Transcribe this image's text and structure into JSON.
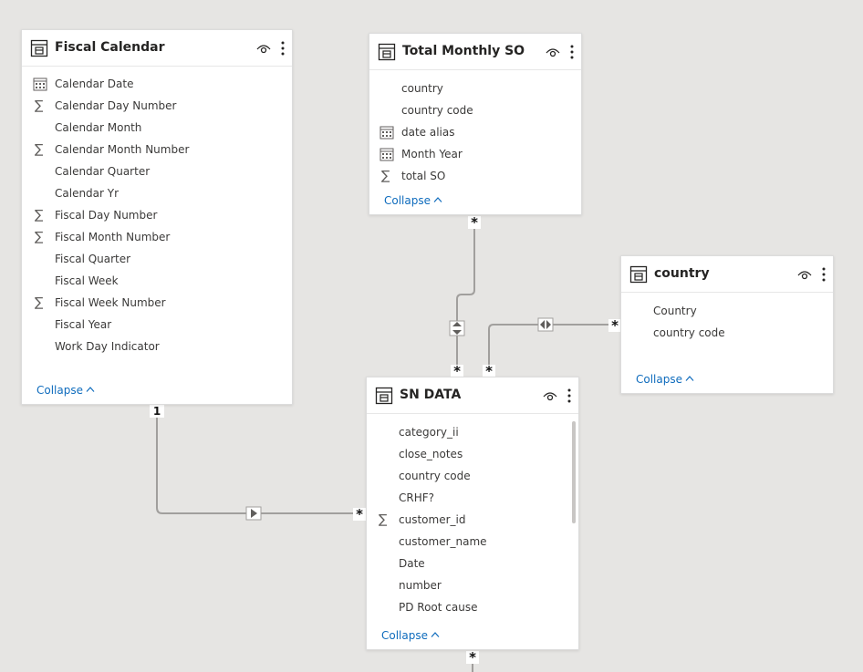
{
  "tables": {
    "fiscal_calendar": {
      "title": "Fiscal Calendar",
      "fields": [
        {
          "label": "Calendar Date",
          "icon": "calendar-icon"
        },
        {
          "label": "Calendar Day Number",
          "icon": "sigma-icon"
        },
        {
          "label": "Calendar Month",
          "icon": ""
        },
        {
          "label": "Calendar Month Number",
          "icon": "sigma-icon"
        },
        {
          "label": "Calendar Quarter",
          "icon": ""
        },
        {
          "label": "Calendar Yr",
          "icon": ""
        },
        {
          "label": "Fiscal Day Number",
          "icon": "sigma-icon"
        },
        {
          "label": "Fiscal Month Number",
          "icon": "sigma-icon"
        },
        {
          "label": "Fiscal Quarter",
          "icon": ""
        },
        {
          "label": "Fiscal Week",
          "icon": ""
        },
        {
          "label": "Fiscal Week Number",
          "icon": "sigma-icon"
        },
        {
          "label": "Fiscal Year",
          "icon": ""
        },
        {
          "label": "Work Day Indicator",
          "icon": ""
        }
      ],
      "collapse_label": "Collapse"
    },
    "total_monthly_so": {
      "title": "Total Monthly SO",
      "fields": [
        {
          "label": "country",
          "icon": ""
        },
        {
          "label": "country code",
          "icon": ""
        },
        {
          "label": "date alias",
          "icon": "calendar-icon"
        },
        {
          "label": "Month Year",
          "icon": "calendar-icon"
        },
        {
          "label": "total SO",
          "icon": "sigma-icon"
        }
      ],
      "collapse_label": "Collapse"
    },
    "country": {
      "title": "country",
      "fields": [
        {
          "label": "Country",
          "icon": ""
        },
        {
          "label": "country code",
          "icon": ""
        }
      ],
      "collapse_label": "Collapse"
    },
    "sn_data": {
      "title": "SN DATA",
      "fields": [
        {
          "label": "category_ii",
          "icon": ""
        },
        {
          "label": "close_notes",
          "icon": ""
        },
        {
          "label": "country code",
          "icon": ""
        },
        {
          "label": "CRHF?",
          "icon": ""
        },
        {
          "label": "customer_id",
          "icon": "sigma-icon"
        },
        {
          "label": "customer_name",
          "icon": ""
        },
        {
          "label": "Date",
          "icon": ""
        },
        {
          "label": "number",
          "icon": ""
        },
        {
          "label": "PD Root cause",
          "icon": ""
        }
      ],
      "collapse_label": "Collapse"
    }
  },
  "relationship_markers": {
    "many": "*",
    "one": "1"
  },
  "colors": {
    "canvas": "#e6e5e3",
    "line": "#a19f9d",
    "link": "#0f6cbd"
  }
}
